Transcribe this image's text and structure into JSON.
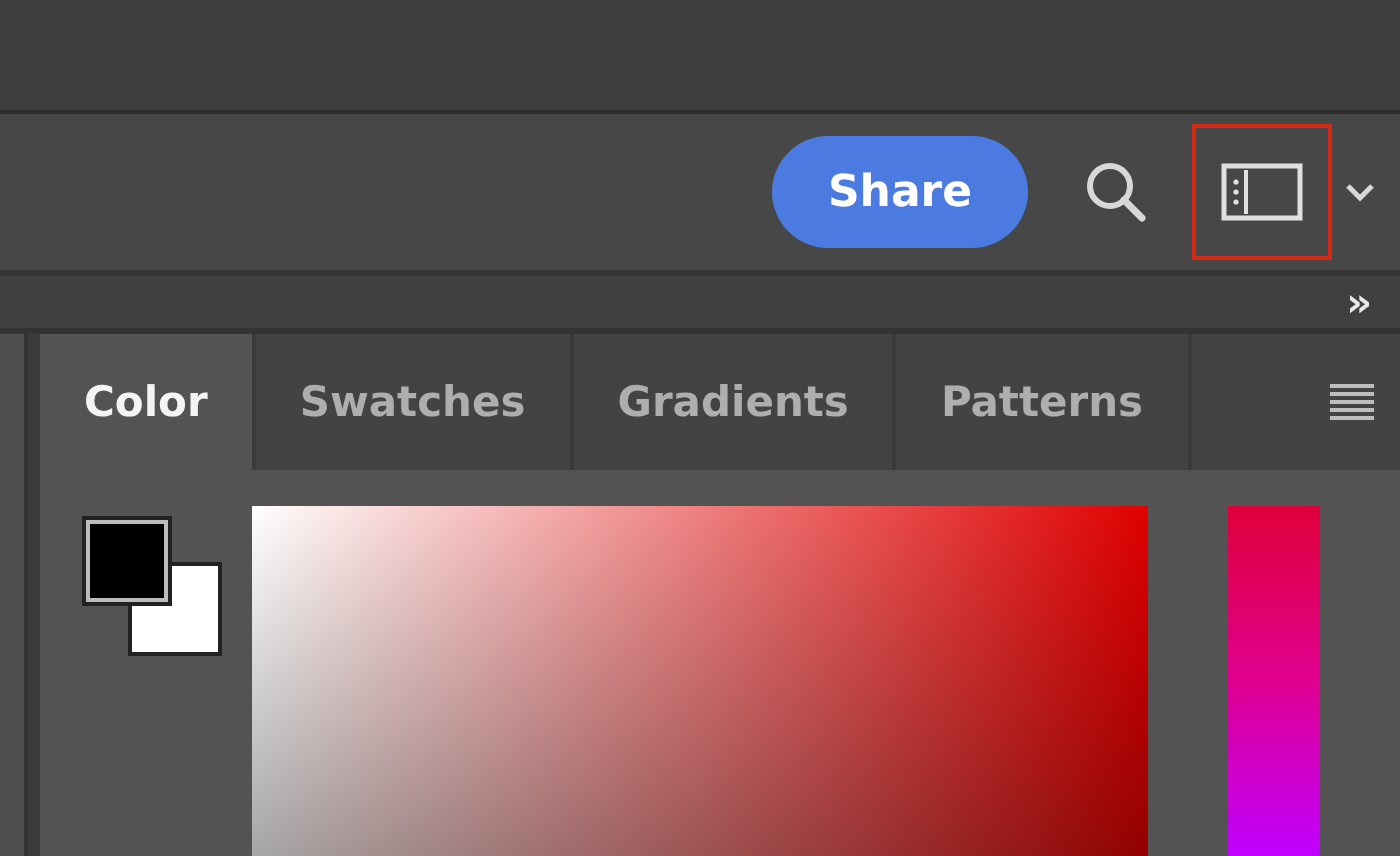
{
  "toolbar": {
    "share_button": "Share",
    "workspace_button": {
      "highlighted": true
    }
  },
  "panel_strip": {
    "collapse_label": "»"
  },
  "color_panel": {
    "tabs": [
      {
        "label": "Color",
        "selected": true
      },
      {
        "label": "Swatches",
        "selected": false
      },
      {
        "label": "Gradients",
        "selected": false
      },
      {
        "label": "Patterns",
        "selected": false
      }
    ]
  }
}
